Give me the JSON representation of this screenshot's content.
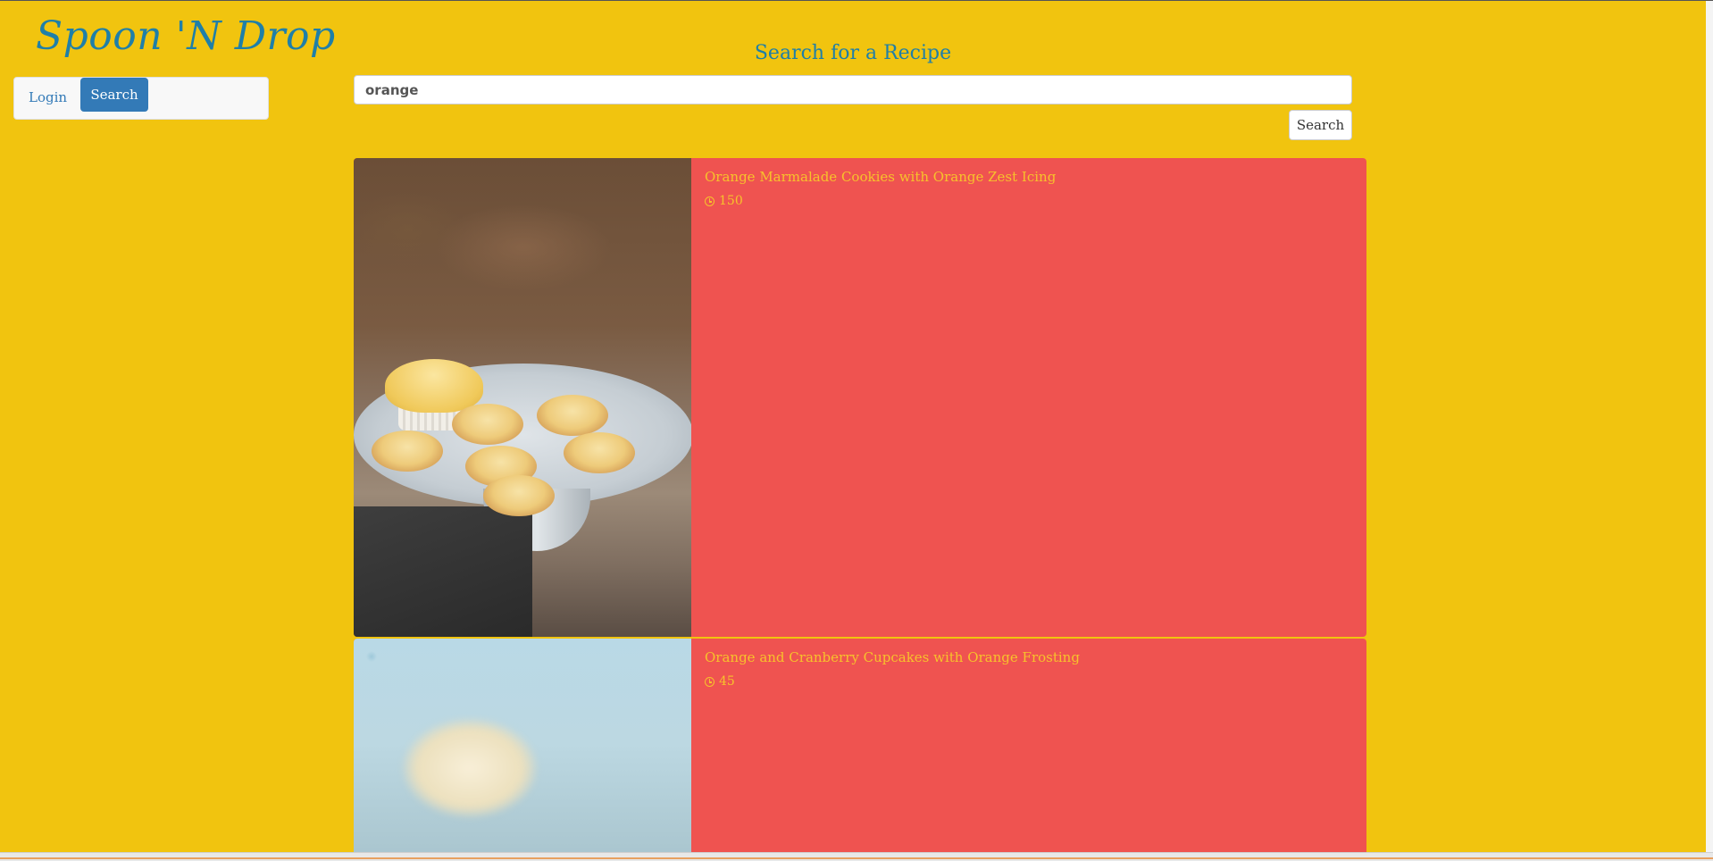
{
  "brand": {
    "title": "Spoon 'N Drop"
  },
  "nav": {
    "login_label": "Login",
    "search_label": "Search"
  },
  "search": {
    "heading": "Search for a Recipe",
    "query": "orange",
    "button_label": "Search"
  },
  "results": [
    {
      "title": "Orange Marmalade Cookies with Orange Zest Icing",
      "time": "150",
      "time_icon": "clock-icon",
      "image": "orange-cookies-photo"
    },
    {
      "title": "Orange and Cranberry Cupcakes with Orange Frosting",
      "time": "45",
      "time_icon": "clock-icon",
      "image": "cupcake-photo"
    }
  ],
  "colors": {
    "background": "#f1c40f",
    "card": "#ef5350",
    "card_text": "#f7c22b",
    "accent": "#1f7fa8",
    "nav_active": "#337ab7"
  }
}
